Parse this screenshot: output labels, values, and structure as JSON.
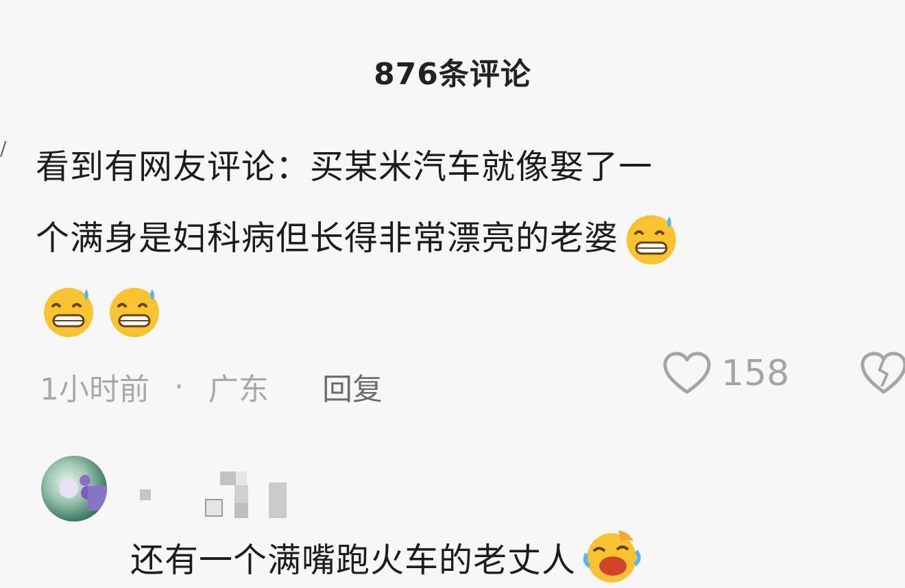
{
  "header": {
    "title": "876条评论"
  },
  "comment": {
    "line1": "看到有网友评论：买某米汽车就像娶了一",
    "line2": "个满身是妇科病但长得非常漂亮的老婆",
    "emojis": [
      "sweat-smile-emoji",
      "sweat-smile-emoji",
      "sweat-smile-emoji"
    ],
    "time": "1小时前",
    "separator": "·",
    "location": "广东",
    "reply_label": "回复",
    "like_count": "158",
    "icons": {
      "like": "heart-outline-icon",
      "dislike": "broken-heart-icon"
    }
  },
  "reply": {
    "text": "还有一个满嘴跑火车的老丈人",
    "emoji": "laughing-crying-emoji"
  },
  "colors": {
    "text": "#1c1c1c",
    "muted": "#a8a8a8",
    "reply_link": "#6d6d6d",
    "background": "#f7f7f7"
  }
}
